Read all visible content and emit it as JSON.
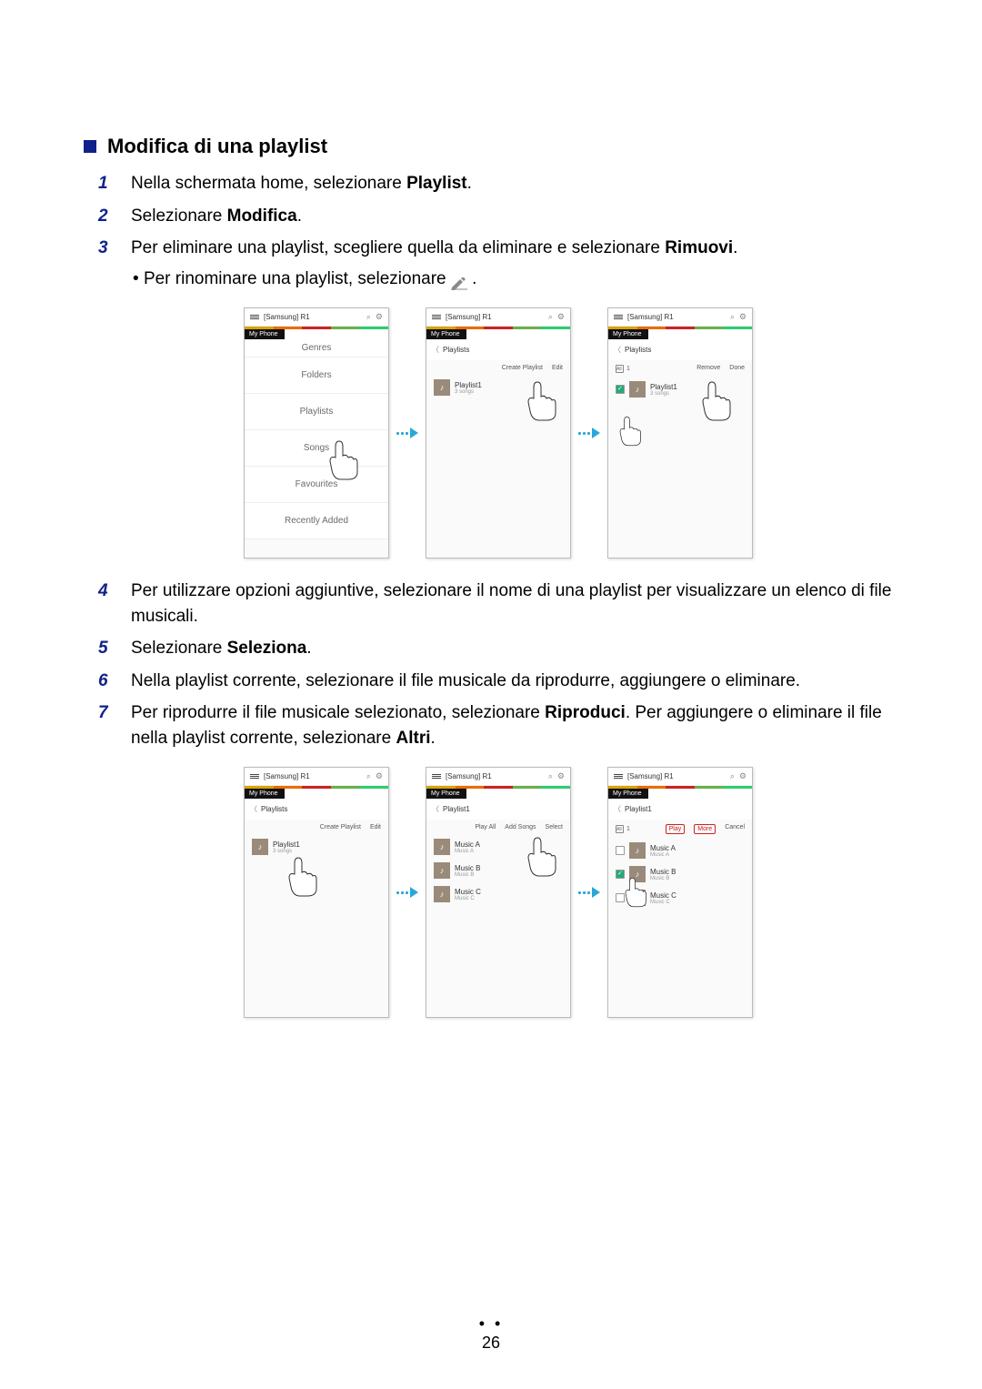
{
  "heading": "Modifica di una playlist",
  "steps": {
    "s1": {
      "num": "1",
      "pre": "Nella schermata home, selezionare ",
      "bold": "Playlist",
      "post": "."
    },
    "s2": {
      "num": "2",
      "pre": "Selezionare ",
      "bold": "Modifica",
      "post": "."
    },
    "s3": {
      "num": "3",
      "pre": "Per eliminare una playlist, scegliere quella da eliminare e selezionare ",
      "bold": "Rimuovi",
      "post": "."
    },
    "s3_sub": "Per rinominare una playlist, selezionare ",
    "s4": {
      "num": "4",
      "text": "Per utilizzare opzioni aggiuntive, selezionare il nome di una playlist per visualizzare un elenco di file musicali."
    },
    "s5": {
      "num": "5",
      "pre": "Selezionare ",
      "bold": "Seleziona",
      "post": "."
    },
    "s6": {
      "num": "6",
      "text": "Nella playlist corrente, selezionare il file musicale da riprodurre, aggiungere o eliminare."
    },
    "s7": {
      "num": "7",
      "pre": "Per riprodurre il file musicale selezionato, selezionare ",
      "bold1": "Riproduci",
      "mid": ". Per aggiungere o eliminare il file nella playlist corrente, selezionare ",
      "bold2": "Altri",
      "post": "."
    }
  },
  "phone": {
    "title": "[Samsung] R1",
    "source": "My Phone",
    "nav_playlists": "Playlists",
    "nav_playlist1": "Playlist1",
    "menu": {
      "genres": "Genres",
      "folders": "Folders",
      "playlists": "Playlists",
      "songs": "Songs",
      "favourites": "Favourites",
      "recently": "Recently Added"
    },
    "actions": {
      "create": "Create Playlist",
      "edit": "Edit",
      "remove": "Remove",
      "done": "Done",
      "playall": "Play All",
      "addsongs": "Add Songs",
      "select": "Select",
      "play": "Play",
      "more": "More",
      "cancel": "Cancel",
      "count1": "1"
    },
    "playlist1": {
      "title": "Playlist1",
      "sub": "3 songs"
    },
    "tracks": {
      "a": {
        "t": "Music A",
        "s": "Music A"
      },
      "b": {
        "t": "Music B",
        "s": "Music B"
      },
      "c": {
        "t": "Music C",
        "s": "Music C"
      }
    }
  },
  "page_number": "26"
}
